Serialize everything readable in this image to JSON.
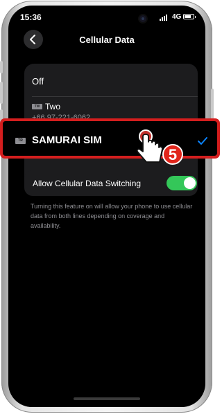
{
  "status_bar": {
    "time": "15:36",
    "network": "4G"
  },
  "nav": {
    "title": "Cellular Data"
  },
  "lines": {
    "off_label": "Off",
    "two": {
      "tag": "TW",
      "name": "Two",
      "number": "+66 97-221-6062"
    },
    "samurai": {
      "tag": "TR",
      "name": "SAMURAI SIM",
      "selected": true
    }
  },
  "switching": {
    "label": "Allow Cellular Data Switching",
    "enabled": true
  },
  "description": "Turning this feature on will allow your phone to use cellular data from both lines depending on coverage and availability.",
  "annotation": {
    "step_number": "5"
  },
  "colors": {
    "accent": "#0a84ff",
    "toggle_on": "#34c759",
    "highlight": "#d41e1e",
    "step_badge": "#e1251b"
  }
}
